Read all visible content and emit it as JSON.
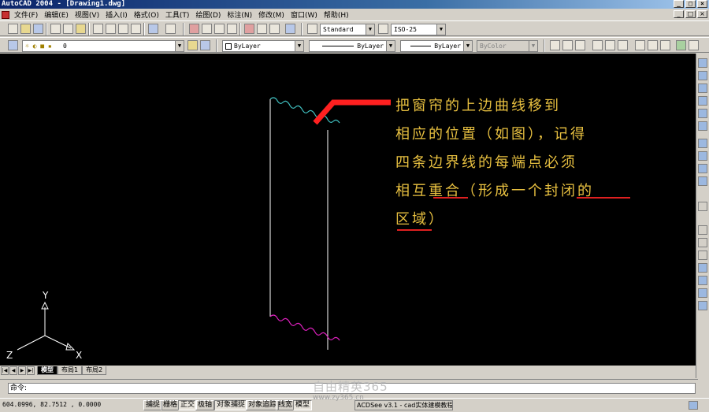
{
  "window": {
    "title": "AutoCAD 2004 - [Drawing1.dwg]"
  },
  "menu": [
    {
      "label": "文件(F)"
    },
    {
      "label": "编辑(E)"
    },
    {
      "label": "视图(V)"
    },
    {
      "label": "插入(I)"
    },
    {
      "label": "格式(O)"
    },
    {
      "label": "工具(T)"
    },
    {
      "label": "绘图(D)"
    },
    {
      "label": "标注(N)"
    },
    {
      "label": "修改(M)"
    },
    {
      "label": "窗口(W)"
    },
    {
      "label": "帮助(H)"
    }
  ],
  "toolbar": {
    "text_style": "Standard",
    "dim_style": "ISO-25",
    "layer": "0",
    "color": "ByLayer",
    "linetype": "ByLayer",
    "lineweight": "ByLayer",
    "plotstyle": "ByColor"
  },
  "annotation": {
    "line1": "把窗帘的上边曲线移到",
    "line2": "相应的位置（如图），记得",
    "line3_a": "四条边界线的每端点必须",
    "line4_a": "相互",
    "line4_b": "重合",
    "line4_c": "（形成一个",
    "line4_d": "封闭的",
    "line5_a": "区域",
    "line5_b": "）"
  },
  "ucs": {
    "x_label": "X",
    "y_label": "Y",
    "z_label": "Z"
  },
  "tabs": [
    {
      "label": "模型"
    },
    {
      "label": "布局1"
    },
    {
      "label": "布局2"
    }
  ],
  "command": {
    "prompt": "命令:"
  },
  "status": {
    "coordinates": "604.0996,   82.7512  , 0.0000",
    "buttons": [
      "捕捉",
      "栅格",
      "正交",
      "极轴",
      "对象捕捉",
      "对象追踪",
      "线宽",
      "模型"
    ]
  },
  "watermark": {
    "brand": "自由精英365",
    "url": "www.zy365.cn"
  },
  "taskbar": {
    "item": "ACDSee v3.1 - cad实体建模教程"
  },
  "colors": {
    "canvas": "#000000",
    "annotation_text": "#e8c040",
    "pointer_arrow": "#ff2020",
    "underline": "#e02020",
    "top_curve": "#40c0c0",
    "bottom_curve": "#e020c0",
    "outline": "#ffffff"
  }
}
